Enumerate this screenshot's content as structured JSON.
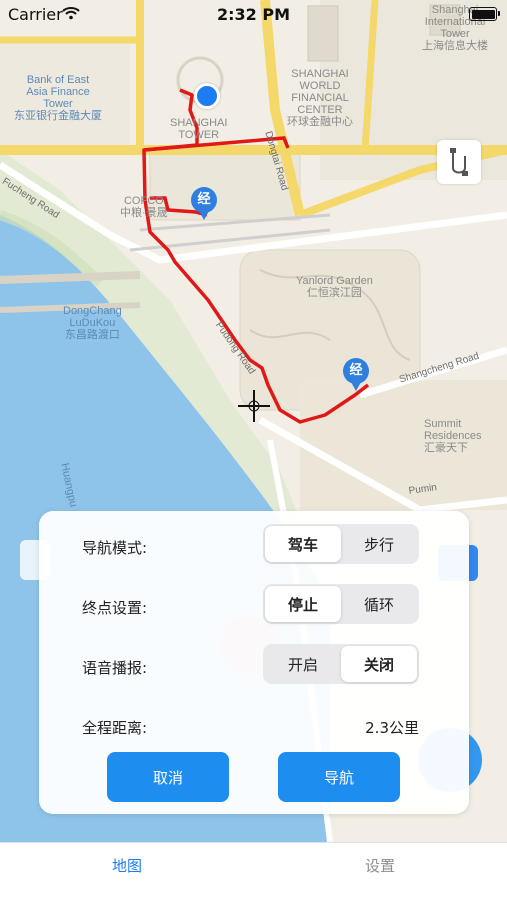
{
  "status": {
    "carrier": "Carrier",
    "time": "2:32 PM"
  },
  "map_labels": {
    "bank": "Bank of East\nAsia Finance\nTower\n东亚银行金融大厦",
    "shanghai_tower": "SHANGHAI\nTOWER",
    "swfc": "SHANGHAI\nWORLD\nFINANCIAL\nCENTER\n环球金融中心",
    "ifc": "Shanghai\nInternational\nTower\n上海信息大楼",
    "cofco": "COFCO\n中粮·景晟",
    "fucheng_road": "Fucheng Road",
    "dongtai_road": "Dongtai Road",
    "yanlord": "Yanlord Garden\n仁恒滨江园",
    "dongchang": "DongChang\nLuDuKou\n东昌路渡口",
    "shangcheng_road": "Shangcheng Road",
    "pudong_road": "Pudong Road",
    "summit": "Summit\nResidences\n汇豪天下",
    "huangpu": "Huangpu",
    "pumin": "Pumin"
  },
  "pins": {
    "waypoint_glyph": "经"
  },
  "panel": {
    "nav_mode_label": "导航模式:",
    "nav_mode_options": [
      "驾车",
      "步行"
    ],
    "endpoint_label": "终点设置:",
    "endpoint_options": [
      "停止",
      "循环"
    ],
    "voice_label": "语音播报:",
    "voice_options": [
      "开启",
      "关闭"
    ],
    "distance_label": "全程距离:",
    "distance_value": "2.3公里",
    "cancel_button": "取消",
    "navigate_button": "导航"
  },
  "tabs": {
    "map": "地图",
    "settings": "设置"
  },
  "colors": {
    "accent": "#1e8df0",
    "route": "#e01818",
    "pin": "#2f7fe0",
    "water": "#8fc4ea"
  }
}
